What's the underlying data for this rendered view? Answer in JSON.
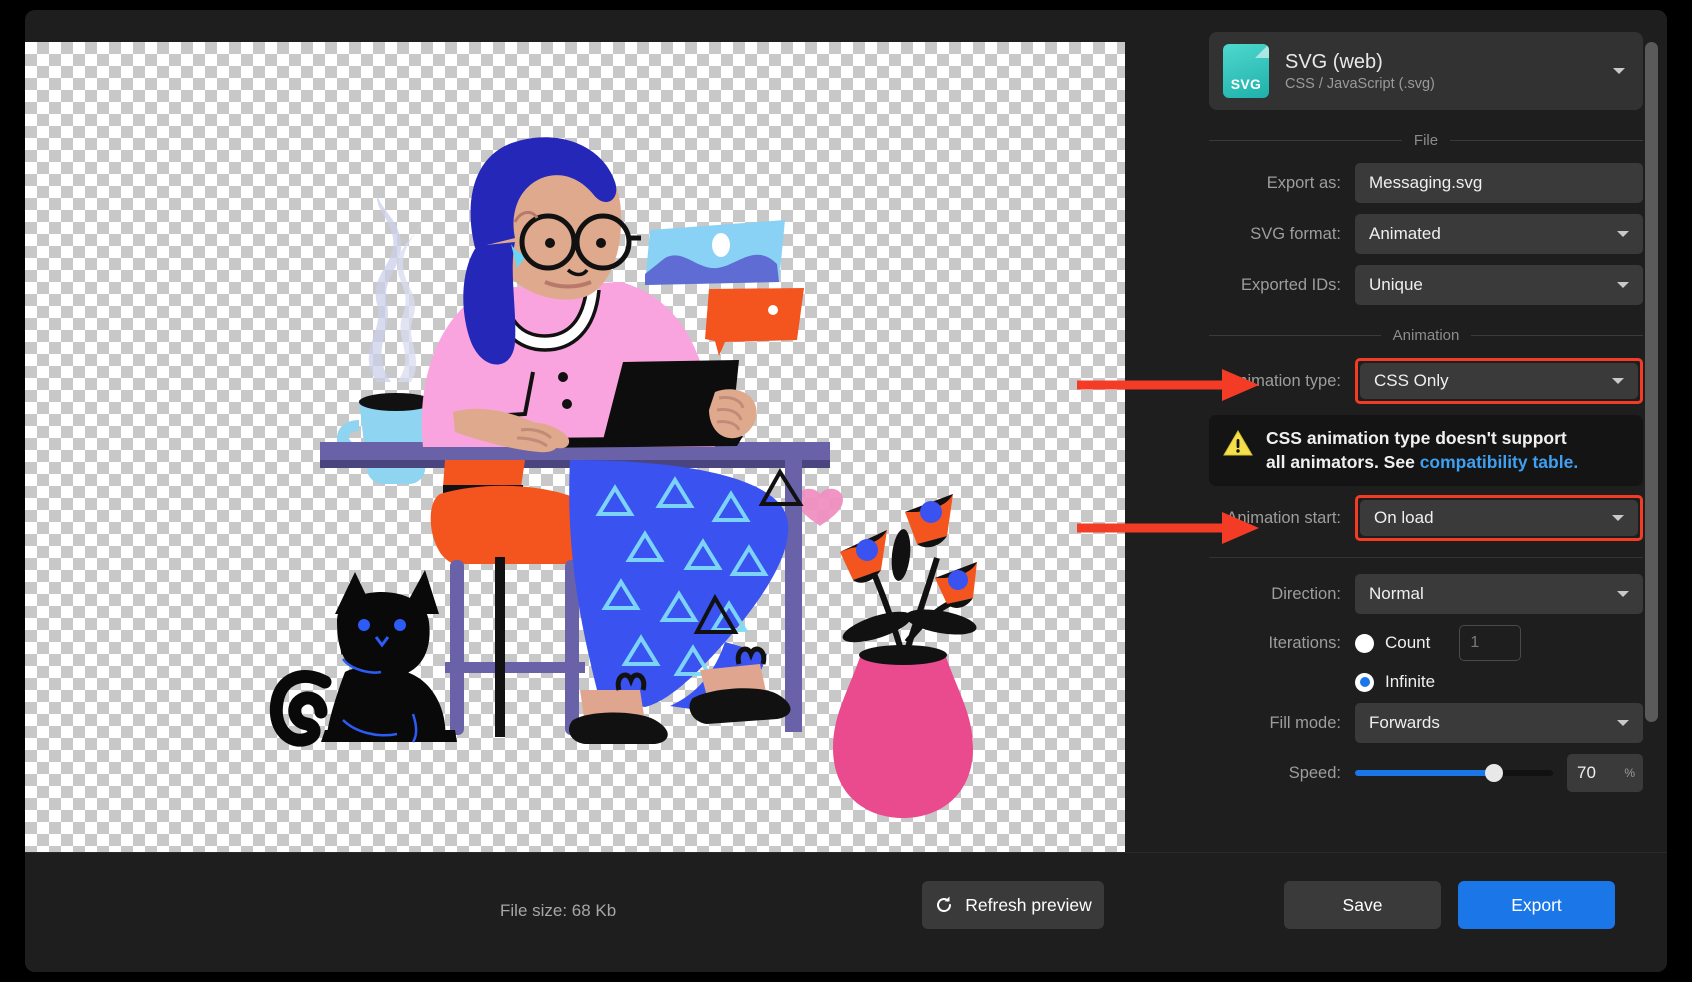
{
  "format_card": {
    "badge_text": "SVG",
    "title": "SVG (web)",
    "subtitle": "CSS / JavaScript (.svg)",
    "caret_icon": "chevron-down-icon"
  },
  "sections": {
    "file_label": "File",
    "animation_label": "Animation"
  },
  "file": {
    "export_as_label": "Export as:",
    "export_as_value": "Messaging.svg",
    "svg_format_label": "SVG format:",
    "svg_format_value": "Animated",
    "exported_ids_label": "Exported IDs:",
    "exported_ids_value": "Unique"
  },
  "animation": {
    "type_label": "Animation type:",
    "type_value": "CSS Only",
    "warning_text_1": "CSS animation type doesn't support",
    "warning_text_2": "all animators. See ",
    "warning_link": "compatibility table.",
    "warning_icon": "warning-triangle-icon",
    "start_label": "Animation start:",
    "start_value": "On load",
    "direction_label": "Direction:",
    "direction_value": "Normal",
    "iterations_label": "Iterations:",
    "count_label": "Count",
    "count_value": "1",
    "count_selected": false,
    "infinite_label": "Infinite",
    "infinite_selected": true,
    "fill_mode_label": "Fill mode:",
    "fill_mode_value": "Forwards",
    "speed_label": "Speed:",
    "speed_value": "70",
    "speed_unit": "%",
    "speed_percent": 70
  },
  "bottom": {
    "file_size": "File size: 68 Kb",
    "refresh_label": "Refresh preview",
    "refresh_icon": "refresh-icon",
    "save_label": "Save",
    "export_label": "Export"
  },
  "colors": {
    "accent_blue": "#1b76e8",
    "highlight_red": "#f43b26",
    "warning_yellow": "#f6e04a",
    "link_blue": "#3f9ff0",
    "panel_bg": "#1e1e1e",
    "field_bg": "#3a3a3a"
  },
  "preview": {
    "alt": "Illustration of a woman working at a desk with a laptop, cat, coffee cup and flower vase on transparent checkerboard background"
  }
}
